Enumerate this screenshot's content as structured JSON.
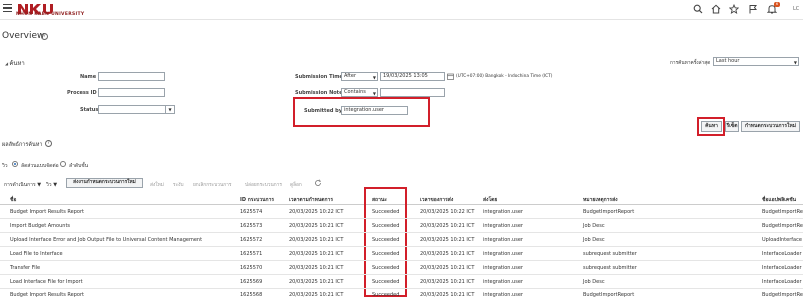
{
  "header": {
    "logo_text": "NHON KAEN UNIVERSITY",
    "notification_count": "6",
    "user_initials": "LC"
  },
  "page": {
    "title": "Overview"
  },
  "search": {
    "section_title": "ค้นหา",
    "name_label": "Name",
    "process_id_label": "Process ID",
    "status_label": "Status",
    "submission_time_label": "Submission Time",
    "submission_time_operator": "After",
    "submission_time_value": "19/03/2025 13:05",
    "timezone": "(UTC+07:00) Bangkok - Indochina Time (ICT)",
    "submission_notes_label": "Submission Notes",
    "submission_notes_operator": "Contains",
    "submitted_by_label": "Submitted by",
    "submitted_by_value": "integration.user",
    "last_label": "การค้นหาครั้งล่าสุด",
    "last_value": "Last hour",
    "search_button": "ค้นหา",
    "reset_button": "รีเซ็ต",
    "schedule_button": "กำหนดกระบวนการใหม่"
  },
  "results": {
    "title": "ผลลัพธ์การค้นหา",
    "view_label": "วิว",
    "radio_list": "ลัดส่วนแบบจัดต่อ",
    "radio_hier": "ลำดับชั้น",
    "actions_menu": "การดำเนินการ",
    "view_menu": "วิว",
    "toolbar": {
      "resubmit": "ส่งงานกำหนดกระบวนการใหม่",
      "put_on_hold": "ส่งใหม่",
      "cancel": "ระงับ",
      "cancel_process": "ยกเลิกกระบวนการ",
      "release": "ปล่อยกระบวนการ",
      "view_log": "ดูล็อก"
    },
    "columns": [
      "ชื่อ",
      "ID กระบวนการ",
      "เวลาตามกำหนดการ",
      "สถานะ",
      "เวลาของการส่ง",
      "ส่งโดย",
      "หมายเหตุการส่ง",
      "ชื่อแอปพลิเคชัน"
    ],
    "rows": [
      [
        "Budget Import Results Report",
        "1625574",
        "20/03/2025 10:22 ICT",
        "Succeeded",
        "20/03/2025 10:22 ICT",
        "integration.user",
        "BudgetImportReport",
        "BudgetImportRe"
      ],
      [
        "Import Budget Amounts",
        "1625573",
        "20/03/2025 10:21 ICT",
        "Succeeded",
        "20/03/2025 10:21 ICT",
        "integration.user",
        "Job Desc",
        "BudgetImportRe"
      ],
      [
        "Upload Interface Error and Job Output File to Universal Content Management",
        "1625572",
        "20/03/2025 10:21 ICT",
        "Succeeded",
        "20/03/2025 10:21 ICT",
        "integration.user",
        "Job Desc",
        "UploadInterface"
      ],
      [
        "Load File to Interface",
        "1625571",
        "20/03/2025 10:21 ICT",
        "Succeeded",
        "20/03/2025 10:21 ICT",
        "integration.user",
        "subrequest submitter",
        "InterfaceLoader"
      ],
      [
        "Transfer File",
        "1625570",
        "20/03/2025 10:21 ICT",
        "Succeeded",
        "20/03/2025 10:21 ICT",
        "integration.user",
        "subrequest submitter",
        "InterfaceLoader"
      ],
      [
        "Load Interface File for Import",
        "1625569",
        "20/03/2025 10:21 ICT",
        "Succeeded",
        "20/03/2025 10:21 ICT",
        "integration.user",
        "Job Desc",
        "InterfaceLoader"
      ],
      [
        "Budget Import Results Report",
        "1625568",
        "20/03/2025 10:21 ICT",
        "Succeeded",
        "20/03/2025 10:21 ICT",
        "integration.user",
        "BudgetImportReport",
        "BudgetImportRe"
      ]
    ]
  }
}
